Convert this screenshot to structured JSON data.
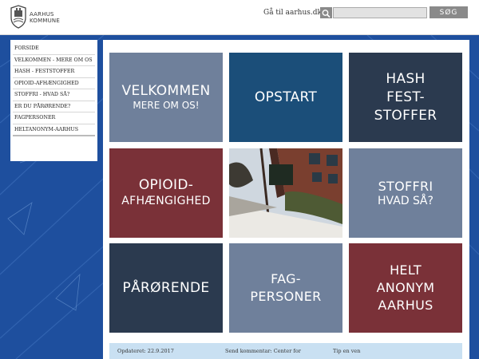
{
  "header": {
    "logo_text": "AARHUS\nKOMMUNE",
    "goto_link": "Gå til aarhus.dk",
    "search_placeholder": "",
    "search_button": "SØG"
  },
  "sidebar": {
    "items": [
      {
        "label": "FORSIDE"
      },
      {
        "label": "VELKOMMEN - MERE OM OS"
      },
      {
        "label": "HASH - FESTSTOFFER"
      },
      {
        "label": "OPIOID-AFHÆNGIGHED"
      },
      {
        "label": "STOFFRI - HVAD SÅ?"
      },
      {
        "label": "ER DU PÅRØRENDE?"
      },
      {
        "label": "FAGPERSONER"
      },
      {
        "label": "HELTANONYM-AARHUS"
      }
    ]
  },
  "tiles": [
    {
      "line1": "VELKOMMEN",
      "line2": "MERE OM OS!",
      "color": "#6f809b"
    },
    {
      "line1": "OPSTART",
      "line2": "",
      "color": "#1b4e79"
    },
    {
      "line1": "HASH\nFEST-\nSTOFFER",
      "line2": "",
      "color": "#2b3a4f"
    },
    {
      "line1": "OPIOID-",
      "line2": "AFHÆNGIGHED",
      "color": "#7a3138"
    },
    {
      "line1": "STOFFRI",
      "line2": "HVAD SÅ?",
      "color": "#6f809b"
    },
    {
      "line1": "PÅRØRENDE",
      "line2": "",
      "color": "#2b3a4f"
    },
    {
      "line1": "FAG-\nPERSONER",
      "line2": "",
      "color": "#6f809b"
    },
    {
      "line1": "HELT\nANONYM\nAARHUS",
      "line2": "",
      "color": "#7a3138"
    }
  ],
  "footer": {
    "updated": "Opdateret: 22.9.2017",
    "comment": "Send kommentar: Center for",
    "tip": "Tip en ven"
  },
  "colors": {
    "background": "#1e4f9e",
    "tile_gray": "#6f809b",
    "tile_blue": "#1b4e79",
    "tile_navy": "#2b3a4f",
    "tile_red": "#7a3138",
    "footer_bg": "#c9e0f2"
  }
}
